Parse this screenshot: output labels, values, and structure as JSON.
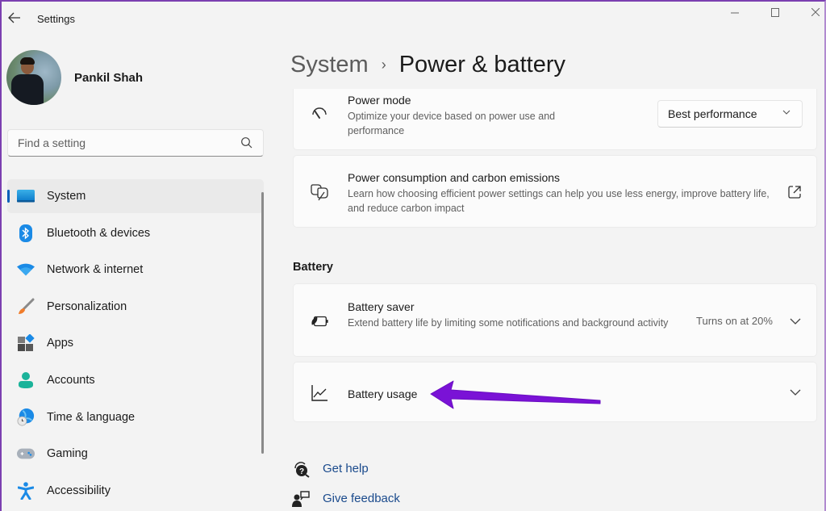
{
  "window": {
    "app_title": "Settings",
    "controls": [
      "minimize",
      "maximize",
      "close"
    ]
  },
  "profile": {
    "name": "Pankil Shah"
  },
  "search": {
    "placeholder": "Find a setting",
    "value": ""
  },
  "sidebar": {
    "items": [
      {
        "label": "System",
        "icon": "system-icon",
        "active": true
      },
      {
        "label": "Bluetooth & devices",
        "icon": "bluetooth-icon",
        "active": false
      },
      {
        "label": "Network & internet",
        "icon": "wifi-icon",
        "active": false
      },
      {
        "label": "Personalization",
        "icon": "paintbrush-icon",
        "active": false
      },
      {
        "label": "Apps",
        "icon": "apps-icon",
        "active": false
      },
      {
        "label": "Accounts",
        "icon": "account-icon",
        "active": false
      },
      {
        "label": "Time & language",
        "icon": "globe-clock-icon",
        "active": false
      },
      {
        "label": "Gaming",
        "icon": "gamepad-icon",
        "active": false
      },
      {
        "label": "Accessibility",
        "icon": "accessibility-icon",
        "active": false
      }
    ]
  },
  "breadcrumb": {
    "parent": "System",
    "separator": "›",
    "current": "Power & battery"
  },
  "cards": {
    "power_mode": {
      "title": "Power mode",
      "description": "Optimize your device based on power use and performance",
      "dropdown_value": "Best performance"
    },
    "carbon": {
      "title": "Power consumption and carbon emissions",
      "description": "Learn how choosing efficient power settings can help you use less energy, improve battery life, and reduce carbon impact"
    },
    "battery_section_heading": "Battery",
    "battery_saver": {
      "title": "Battery saver",
      "description": "Extend battery life by limiting some notifications and background activity",
      "status": "Turns on at 20%"
    },
    "battery_usage": {
      "title": "Battery usage"
    }
  },
  "annotation": {
    "arrow_color": "#7a12d6",
    "points_to": "Battery usage"
  },
  "help": {
    "get_help": "Get help",
    "give_feedback": "Give feedback"
  },
  "colors": {
    "accent": "#005fb8",
    "link": "#1a4a8c",
    "window_border": "#7b3fb0"
  }
}
